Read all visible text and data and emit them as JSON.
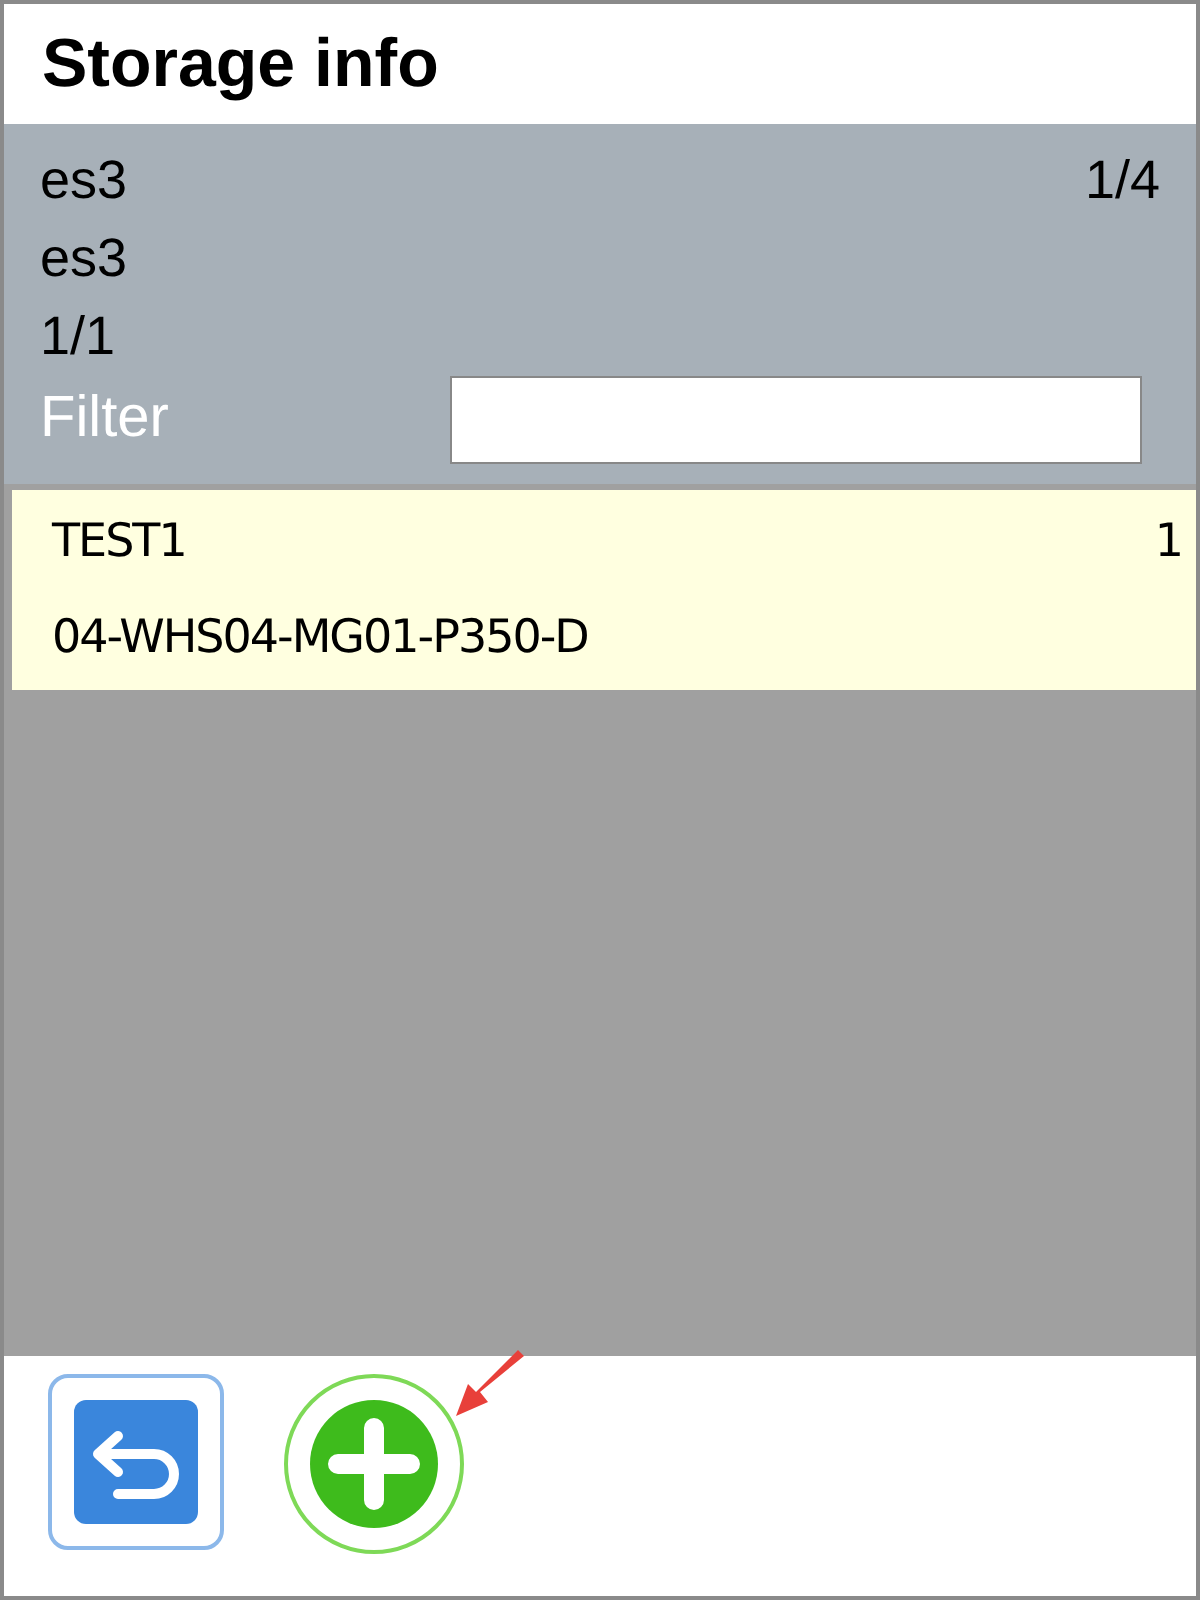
{
  "title": "Storage info",
  "header": {
    "line_1": "es3",
    "page": "1/4",
    "line_2": "es3",
    "line_3": "1/1",
    "filter_label": "Filter"
  },
  "items": [
    {
      "name": "TEST1",
      "quantity": "1",
      "location": "04-WHS04-MG01-P350-D"
    }
  ],
  "buttons": [
    {
      "kind": "back"
    },
    {
      "kind": "add"
    }
  ]
}
